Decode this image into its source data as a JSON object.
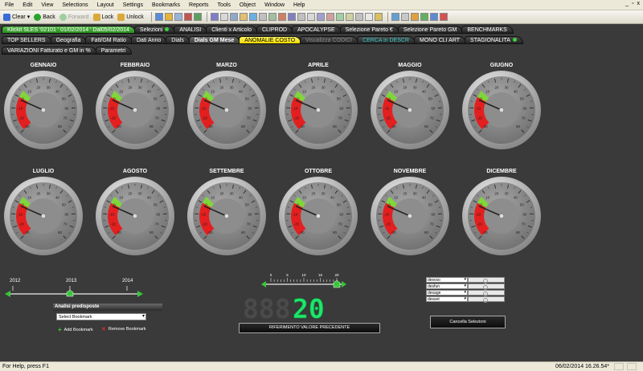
{
  "menu": [
    "File",
    "Edit",
    "View",
    "Selections",
    "Layout",
    "Settings",
    "Bookmarks",
    "Reports",
    "Tools",
    "Object",
    "Window",
    "Help"
  ],
  "window_controls": [
    "_",
    "▫",
    "x"
  ],
  "toolbar": {
    "clear": "Clear",
    "back": "Back",
    "forward": "Forward",
    "lock": "Lock",
    "unlock": "Unlock"
  },
  "tabs_row1": [
    {
      "label": "Klickit SLES '02101 ' 01/02/2014 ' Dal05/02/2014",
      "style": "green"
    },
    {
      "label": "Selezioni",
      "style": "normal",
      "dot": true
    },
    {
      "label": "ANALISI",
      "style": "normal"
    },
    {
      "label": "Clienti x Articolo",
      "style": "normal"
    },
    {
      "label": "CLIPROD",
      "style": "normal"
    },
    {
      "label": "APOCALYPSE",
      "style": "normal"
    },
    {
      "label": "Selezione Pareto €",
      "style": "normal"
    },
    {
      "label": "Selezione Pareto GM",
      "style": "normal"
    },
    {
      "label": "BENCHMARKS",
      "style": "normal"
    }
  ],
  "tabs_row2": [
    {
      "label": "TOP SELLERS",
      "style": "normal"
    },
    {
      "label": "Geografia",
      "style": "normal"
    },
    {
      "label": "Fatt/GM Ratio",
      "style": "normal"
    },
    {
      "label": "Dati Anno",
      "style": "normal"
    },
    {
      "label": "Dials",
      "style": "normal"
    },
    {
      "label": "Dials GM Mese",
      "style": "sel"
    },
    {
      "label": "ANOMALIE COSTO",
      "style": "active"
    },
    {
      "label": "Visualizza CODICI",
      "style": "dim"
    },
    {
      "label": "CERCA in DESCR",
      "style": "cyan"
    },
    {
      "label": "MONO CLI ART",
      "style": "normal"
    },
    {
      "label": "STAGIONALITA",
      "style": "normal",
      "dot": true
    }
  ],
  "tabs_row3": [
    {
      "label": "VARIAZIONI Fatturato e GM in  %",
      "style": "normal"
    },
    {
      "label": "Parametri",
      "style": "normal"
    }
  ],
  "gauge_scale": [
    "-30",
    "-20",
    "-10",
    "0",
    "10",
    "20",
    "30",
    "40",
    "50",
    "60",
    "70",
    "80"
  ],
  "gauges": [
    {
      "month": "GENNAIO",
      "needle": -2
    },
    {
      "month": "FEBBRAIO",
      "needle": -2
    },
    {
      "month": "MARZO",
      "needle": -2
    },
    {
      "month": "APRILE",
      "needle": -2
    },
    {
      "month": "MAGGIO",
      "needle": -2
    },
    {
      "month": "GIUGNO",
      "needle": -2
    },
    {
      "month": "LUGLIO",
      "needle": -2
    },
    {
      "month": "AGOSTO",
      "needle": -2
    },
    {
      "month": "SETTEMBRE",
      "needle": -2
    },
    {
      "month": "OTTOBRE",
      "needle": -2
    },
    {
      "month": "NOVEMBRE",
      "needle": -2
    },
    {
      "month": "DICEMBRE",
      "needle": -2
    }
  ],
  "year_slider": {
    "labels": [
      "2012",
      "2013",
      "2014"
    ]
  },
  "bookmarks": {
    "title": "Analisi predisposte",
    "select": "Select Bookmark",
    "add": "Add Bookmark",
    "remove": "Remove Bookmark"
  },
  "threshold_slider": {
    "ticks": [
      "0",
      "5",
      "10",
      "15",
      "20"
    ]
  },
  "led": {
    "ghost": "888",
    "value": "20"
  },
  "riferimento_button": "RIFERIMENTO VALORE PRECEDENTE",
  "cancella_button": "Cancella Selezioni",
  "listbox": [
    "desvso",
    "desfun",
    "desage",
    "desset"
  ],
  "status": {
    "left": "For Help, press F1",
    "time": "06/02/2014 16.26.54*"
  },
  "colors": {
    "red_zone": "#e41f1f",
    "green_zone": "#7fd63a",
    "led": "#1ee66b"
  }
}
